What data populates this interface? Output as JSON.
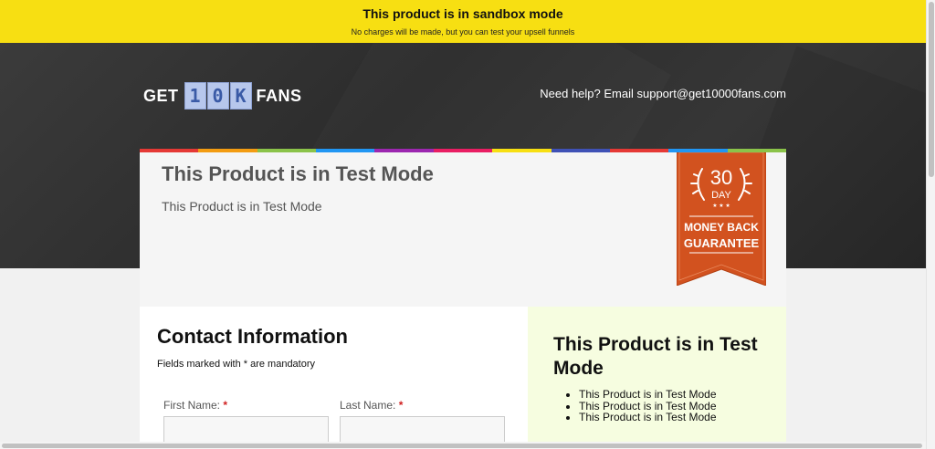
{
  "sandbox_banner": {
    "title": "This product is in sandbox mode",
    "subtitle": "No charges will be made, but you can test your upsell funnels",
    "color": "#f7df12"
  },
  "header": {
    "logo": {
      "prefix": "GET",
      "tiles": [
        "1",
        "0",
        "K"
      ],
      "suffix": "FANS"
    },
    "help_text": "Need help? Email support@get10000fans.com"
  },
  "rainbow_colors": [
    "#e53935",
    "#f39c12",
    "#8bc34a",
    "#2196f3",
    "#9c27b0",
    "#e91e63",
    "#f7df12",
    "#3f51b5",
    "#e53935",
    "#2196f3",
    "#8bc34a"
  ],
  "product": {
    "title": "This Product is in Test Mode",
    "description": "This Product is in Test Mode"
  },
  "guarantee_badge": {
    "days": "30",
    "day_label": "DAY",
    "line1": "MONEY BACK",
    "line2": "GUARANTEE",
    "color": "#d2521f"
  },
  "contact": {
    "title": "Contact Information",
    "note": "Fields marked with * are mandatory",
    "first_name_label": "First Name:",
    "last_name_label": "Last Name:",
    "required_mark": "*"
  },
  "summary": {
    "title": "This Product is in Test Mode",
    "items": [
      "This Product is in Test Mode",
      "This Product is in Test Mode",
      "This Product is in Test Mode"
    ]
  }
}
